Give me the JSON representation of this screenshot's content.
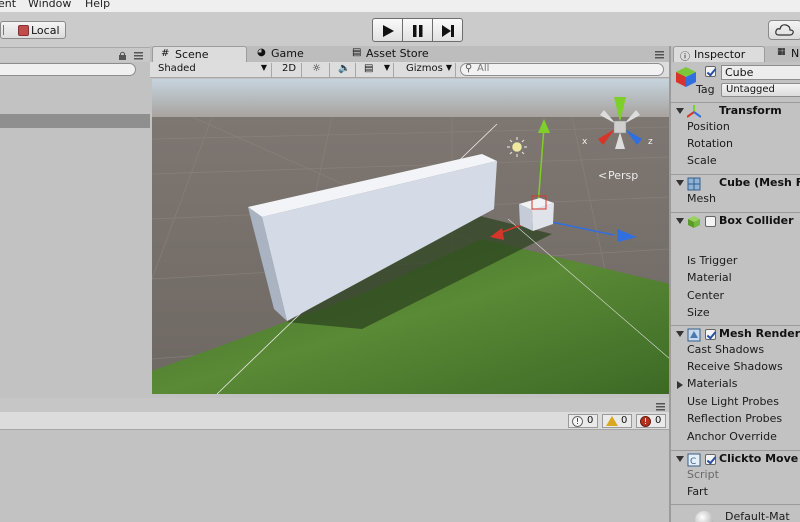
{
  "menu": {
    "item_partial": "ent",
    "window": "Window",
    "help": "Help"
  },
  "toolbar": {
    "local_label": "Local"
  },
  "scene_tabs": {
    "scene": "Scene",
    "game": "Game",
    "asset_store": "Asset Store"
  },
  "scene_toolbar": {
    "shading": "Shaded",
    "mode_2d": "2D",
    "gizmos": "Gizmos",
    "search_placeholder": "All"
  },
  "scene_view": {
    "persp_label": "Persp",
    "axis_x": "x",
    "axis_z": "z"
  },
  "console": {
    "info_count": "0",
    "warning_count": "0",
    "error_count": "0"
  },
  "inspector": {
    "tab_inspector": "Inspector",
    "tab_partial": "N",
    "object_name": "Cube",
    "tag_label": "Tag",
    "tag_value": "Untagged",
    "transform": {
      "title": "Transform",
      "position": "Position",
      "rotation": "Rotation",
      "scale": "Scale"
    },
    "mesh_filter": {
      "title": "Cube (Mesh F",
      "mesh": "Mesh"
    },
    "box_collider": {
      "title": "Box Collider",
      "is_trigger": "Is Trigger",
      "material": "Material",
      "center": "Center",
      "size": "Size"
    },
    "mesh_renderer": {
      "title": "Mesh Render",
      "cast_shadows": "Cast Shadows",
      "receive_shadows": "Receive Shadows",
      "materials": "Materials",
      "use_light_probes": "Use Light Probes",
      "reflection_probes": "Reflection Probes",
      "anchor_override": "Anchor Override"
    },
    "script_component": {
      "title": "Clickto Move",
      "script": "Script",
      "fart": "Fart"
    },
    "material_preview": "Default-Mat"
  },
  "colors": {
    "panel_bg": "#c2c2c2",
    "selection": "#8f8f8f",
    "gizmo_x": "#d8352a",
    "gizmo_y": "#7fcf2a",
    "gizmo_z": "#2f6fe0",
    "ground": "#4f7a2e",
    "sky": "#c9d8e3"
  }
}
